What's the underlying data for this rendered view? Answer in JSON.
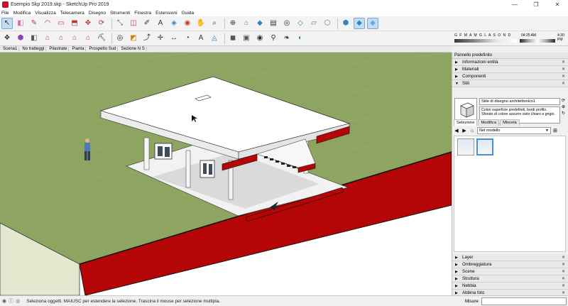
{
  "window": {
    "title": "Esempio Skp 2019.skp - SketchUp Pro 2019",
    "minimize_glyph": "—",
    "maximize_glyph": "❐",
    "close_glyph": "✕"
  },
  "menu": [
    "File",
    "Modifica",
    "Visualizza",
    "Telecamera",
    "Disegno",
    "Strumenti",
    "Finestra",
    "Estensioni",
    "Guida"
  ],
  "toolbar_row1": [
    {
      "icon": "select-arrow-icon",
      "glyph": "↖",
      "color": "#2a2a2a",
      "selected": true
    },
    {
      "icon": "eraser-icon",
      "glyph": "◧",
      "color": "#d8729d"
    },
    {
      "icon": "pencil-line-icon",
      "glyph": "✎",
      "color": "#c0392b"
    },
    {
      "icon": "arc-icon",
      "glyph": "◠",
      "color": "#c0392b"
    },
    {
      "icon": "rectangle-icon",
      "glyph": "▭",
      "color": "#c0392b"
    },
    {
      "icon": "push-pull-icon",
      "glyph": "⬒",
      "color": "#b03a2e"
    },
    {
      "icon": "move-icon",
      "glyph": "✥",
      "color": "#b03a2e"
    },
    {
      "icon": "rotate-icon",
      "glyph": "⟳",
      "color": "#b03a2e"
    },
    {
      "icon": "scale-icon",
      "glyph": "⤡",
      "color": "#b03a2e"
    },
    {
      "icon": "offset-icon",
      "glyph": "◫",
      "color": "#b03a2e"
    },
    {
      "icon": "tape-measure-icon",
      "glyph": "✐",
      "color": "#333"
    },
    {
      "icon": "text-icon",
      "glyph": "A",
      "color": "#333"
    },
    {
      "icon": "paint-bucket-icon",
      "glyph": "◈",
      "color": "#2e86c1"
    },
    {
      "icon": "orbit-icon",
      "glyph": "◉",
      "color": "#c0392b"
    },
    {
      "icon": "pan-icon",
      "glyph": "✋",
      "color": "#333"
    },
    {
      "icon": "zoom-icon",
      "glyph": "⌕",
      "color": "#333"
    },
    {
      "icon": "zoom-extents-icon",
      "glyph": "⊕",
      "color": "#333"
    },
    {
      "icon": "warehouse-icon",
      "glyph": "⌂",
      "color": "#2e86c1"
    },
    {
      "icon": "extension-warehouse-icon",
      "glyph": "◆",
      "color": "#2e86c1"
    },
    {
      "icon": "layout-icon",
      "glyph": "▤",
      "color": "#333"
    },
    {
      "icon": "geo-location-icon",
      "glyph": "◎",
      "color": "#333"
    },
    {
      "icon": "xray-icon",
      "glyph": "◇",
      "color": "#2e86c1"
    },
    {
      "icon": "back-edges-icon",
      "glyph": "▱",
      "color": "#2e86c1"
    },
    {
      "icon": "wireframe-icon",
      "glyph": "⬡",
      "color": "#2e86c1"
    },
    {
      "icon": "hidden-line-icon",
      "glyph": "⬢",
      "color": "#2e86c1"
    },
    {
      "icon": "shaded-icon",
      "glyph": "◆",
      "color": "#2e86c1",
      "selected": true
    },
    {
      "icon": "shaded-textures-icon",
      "glyph": "◆",
      "color": "#5dade2",
      "selected": true
    }
  ],
  "toolbar_row2": [
    {
      "icon": "make-component-icon",
      "glyph": "❖",
      "color": "#333"
    },
    {
      "icon": "iso-view-icon",
      "glyph": "⬢",
      "color": "#8e44ad"
    },
    {
      "icon": "top-view-icon",
      "glyph": "◧",
      "color": "#555"
    },
    {
      "icon": "front-view-icon",
      "glyph": "⌂",
      "color": "#c0392b"
    },
    {
      "icon": "right-view-icon",
      "glyph": "⌂",
      "color": "#c0392b"
    },
    {
      "icon": "back-view-icon",
      "glyph": "⌂",
      "color": "#c0392b"
    },
    {
      "icon": "left-view-icon",
      "glyph": "⌂",
      "color": "#c0392b"
    },
    {
      "icon": "walk-icon",
      "glyph": "⛏",
      "color": "#333"
    },
    {
      "icon": "look-around-icon",
      "glyph": "◎",
      "color": "#333"
    },
    {
      "icon": "section-plane-icon",
      "glyph": "◩",
      "color": "#c87f0a"
    },
    {
      "icon": "follow-me-icon",
      "glyph": "⤴",
      "color": "#333"
    },
    {
      "icon": "axes-icon",
      "glyph": "✛",
      "color": "#333"
    },
    {
      "icon": "dimension-icon",
      "glyph": "↔",
      "color": "#333"
    },
    {
      "icon": "protractor-icon",
      "glyph": "◔",
      "color": "#333"
    },
    {
      "icon": "3d-text-icon",
      "glyph": "A",
      "color": "#333"
    },
    {
      "icon": "sandbox-icon",
      "glyph": "◬",
      "color": "#2e86c1"
    },
    {
      "icon": "solid-tools-icon",
      "glyph": "◼",
      "color": "#555"
    },
    {
      "icon": "camera-icon",
      "glyph": "▣",
      "color": "#555"
    },
    {
      "icon": "position-camera-icon",
      "glyph": "◉",
      "color": "#333"
    },
    {
      "icon": "walkthrough-icon",
      "glyph": "⚲",
      "color": "#333"
    },
    {
      "icon": "footprint-icon",
      "glyph": "❧",
      "color": "#333"
    },
    {
      "icon": "lookaround-icon",
      "glyph": "◐",
      "color": "#2e86c1"
    }
  ],
  "shadow": {
    "months": "G F M A M G L A S O N D",
    "time": "04:25 AM",
    "midday": "Mezzogiorno",
    "time_end": "4:30 PM"
  },
  "scenes": [
    "Scena1",
    "No tratteggi",
    "Pilastrate",
    "Pianta",
    "Prospetto Sud",
    "Sezione N S"
  ],
  "panel": {
    "title": "Pannello predefinito",
    "top_trays": [
      {
        "label": "Informazioni entità",
        "expanded": false
      },
      {
        "label": "Materiali",
        "expanded": false
      },
      {
        "label": "Componenti",
        "expanded": false
      },
      {
        "label": "Stili",
        "expanded": true
      }
    ],
    "style_name": "Stile di disegno architettonico1",
    "style_desc": "Colori superficie predefiniti, bordi profilo. Sfondo di colore azzurro cielo chiaro e grigio.",
    "tabs": [
      "Selezione",
      "Modifica",
      "Miscela"
    ],
    "library": "Nel modello",
    "bottom_trays": [
      "Layer",
      "Ombreggiatura",
      "Scene",
      "Struttura",
      "Nebbia",
      "Abbina foto"
    ]
  },
  "status": {
    "message": "Seleziona oggetti. MAIUSC per estendere la selezione. Trascina il mouse per selezione multipla.",
    "measure_label": "Misure"
  },
  "colors": {
    "grass": "#8da560",
    "sky": "#ffffff",
    "red_section": "#b40606",
    "selection_blue": "#c7dcf2"
  }
}
